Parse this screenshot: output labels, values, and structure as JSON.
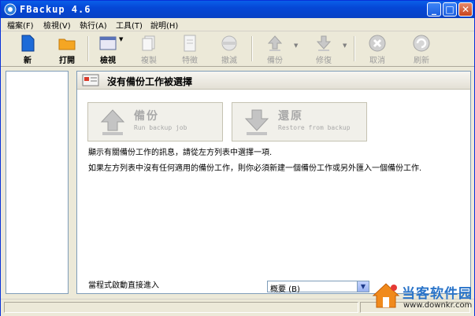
{
  "window": {
    "title": "FBackup  4.6"
  },
  "menu": [
    "檔案(F)",
    "檢視(V)",
    "執行(A)",
    "工具(T)",
    "說明(H)"
  ],
  "toolbar": {
    "new": "新",
    "open": "打開",
    "view": "檢視",
    "copy": "複製",
    "props": "特徵",
    "remove": "撤滅",
    "backup": "備份",
    "restore": "修復",
    "cancel": "取消",
    "refresh": "刷新"
  },
  "main": {
    "header_title": "沒有備份工作被選擇",
    "backup_btn": {
      "title": "備份",
      "subtitle": "Run backup job"
    },
    "restore_btn": {
      "title": "還原",
      "subtitle": "Restore from backup"
    },
    "info1": "顯示有關備份工作的訊息，請從左方列表中選擇一項.",
    "info2": "如果左方列表中沒有任何適用的備份工作，則你必須新建一個備份工作或另外匯入一個備份工作.",
    "footer_label": "當程式啟動直接進入",
    "view_select": "概要 (B)"
  },
  "watermark": {
    "text": "当客软件园",
    "url": "www.downkr.com"
  },
  "colors": {
    "titlebar": "#0547d6",
    "accent": "#2a74c9"
  }
}
